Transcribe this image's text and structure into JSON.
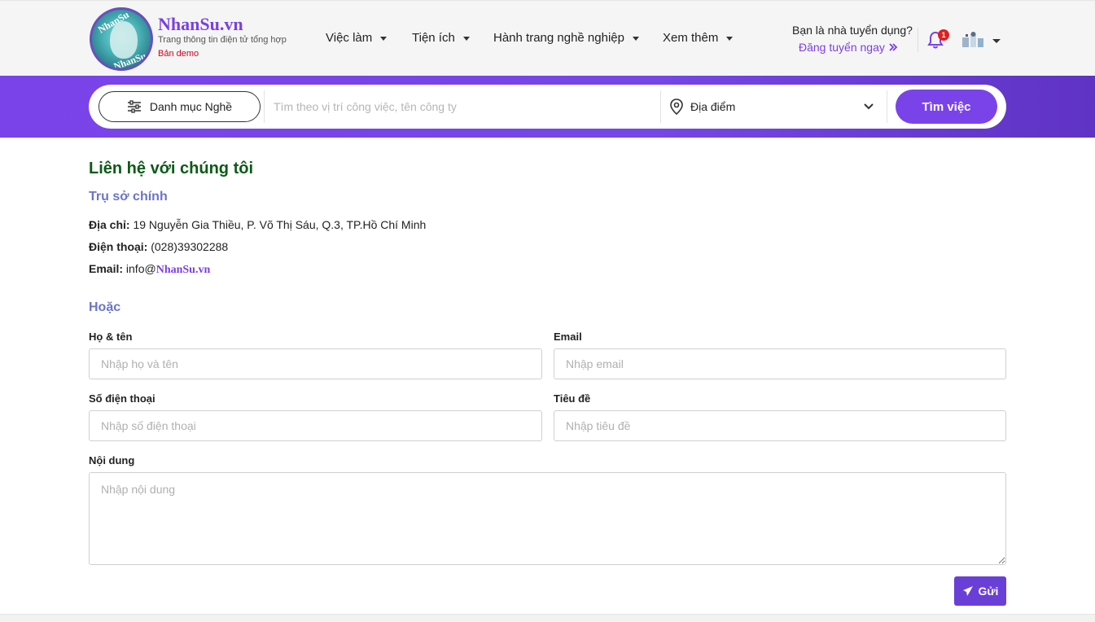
{
  "header": {
    "brand": "NhanSu.vn",
    "tagline": "Trang thông tin điện tử tổng hợp",
    "demo": "Bản demo",
    "logo_text_top": "NhanSu",
    "logo_text_bottom": "NhanSu",
    "nav": [
      {
        "label": "Việc làm"
      },
      {
        "label": "Tiện ích"
      },
      {
        "label": "Hành trang nghề nghiệp"
      },
      {
        "label": "Xem thêm"
      }
    ],
    "recruiter_question": "Bạn là nhà tuyển dụng?",
    "recruiter_link": "Đăng tuyển ngay",
    "notification_count": "1"
  },
  "search": {
    "category_label": "Danh mục Nghề",
    "keyword_placeholder": "Tìm theo vị trí công việc, tên công ty",
    "location_label": "Địa điểm",
    "button_label": "Tìm việc"
  },
  "contact": {
    "title": "Liên hệ với chúng tôi",
    "office_title": "Trụ sở chính",
    "address_label": "Địa chỉ:",
    "address_value": "19 Nguyễn Gia Thiều, P. Võ Thị Sáu, Q.3, TP.Hồ Chí Minh",
    "phone_label": "Điện thoại:",
    "phone_value": "(028)39302288",
    "email_label": "Email:",
    "email_prefix": "info@",
    "email_brand": "NhanSu.vn",
    "or_title": "Hoặc"
  },
  "form": {
    "name_label": "Họ & tên",
    "name_placeholder": "Nhập họ và tên",
    "email_label": "Email",
    "email_placeholder": "Nhập email",
    "phone_label": "Số điện thoại",
    "phone_placeholder": "Nhập số điện thoại",
    "subject_label": "Tiêu đề",
    "subject_placeholder": "Nhập tiêu đề",
    "content_label": "Nội dung",
    "content_placeholder": "Nhập nội dung",
    "submit_label": "Gửi"
  },
  "colors": {
    "brand_purple": "#7a43ea",
    "title_green": "#0b5b16",
    "subtitle_blue": "#6b74c9"
  }
}
